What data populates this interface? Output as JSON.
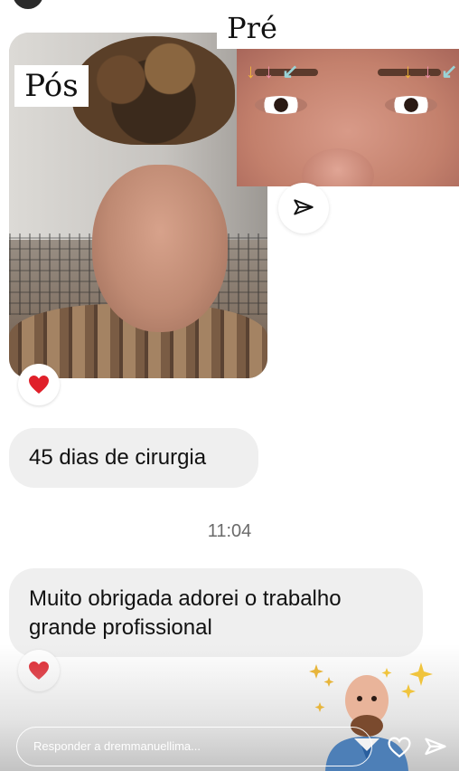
{
  "labels": {
    "post": "Pós",
    "pre": "Pré"
  },
  "messages": [
    {
      "text": "45 dias de cirurgia"
    },
    {
      "time": "11:04"
    },
    {
      "text": "Muito obrigada adorei o trabalho grande profissional"
    }
  ],
  "reply": {
    "placeholder": "Responder a dremmanuellima..."
  },
  "icons": {
    "share": "paper-plane-icon",
    "reaction": "red-heart-icon",
    "like": "heart-outline-icon",
    "send": "send-icon"
  },
  "colors": {
    "bubble": "#efefef",
    "heart": "#e0202a",
    "time": "#6b6b6b"
  }
}
